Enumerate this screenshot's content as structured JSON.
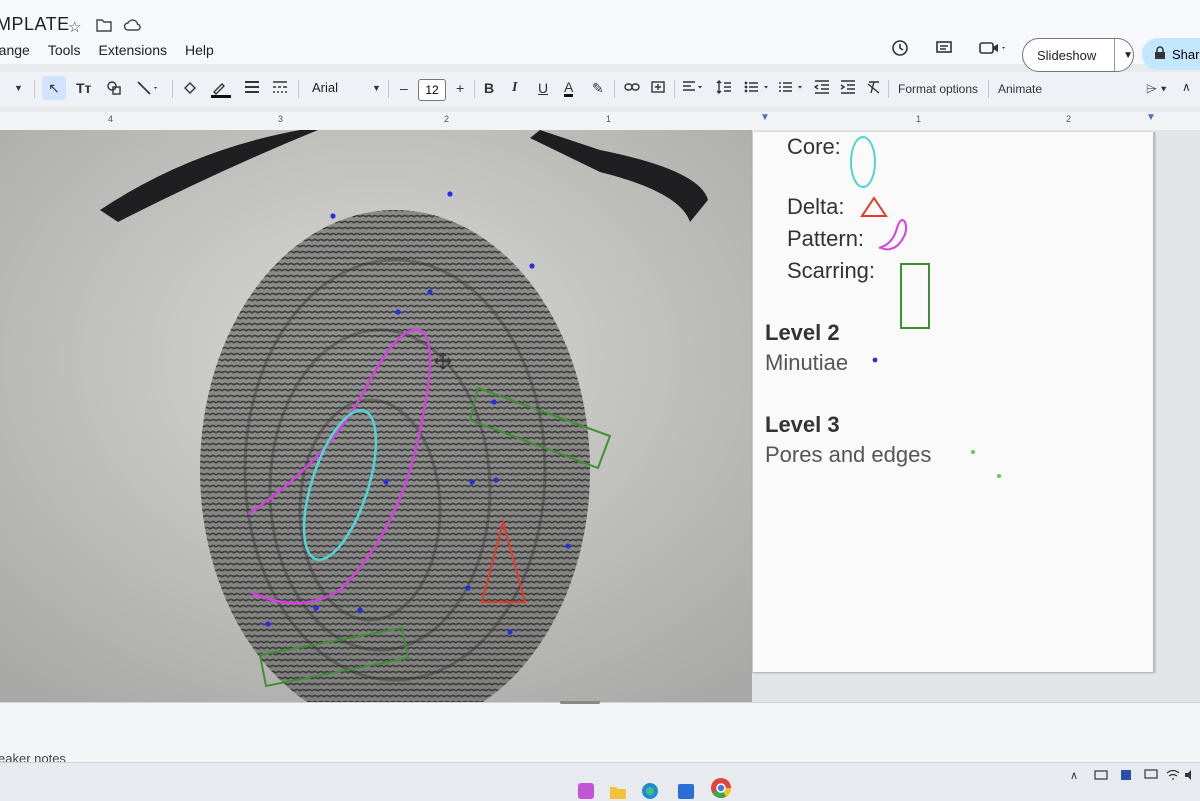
{
  "app": {
    "title_partial": "MPLATE",
    "menu": [
      "range",
      "Tools",
      "Extensions",
      "Help"
    ]
  },
  "header_actions": {
    "slideshow_label": "Slideshow",
    "share_label": "Share"
  },
  "toolbar": {
    "font_name": "Arial",
    "font_size": "12",
    "format_options": "Format options",
    "animate": "Animate",
    "bold": "B",
    "italic": "I",
    "underline": "U",
    "text_color": "A",
    "minus": "–",
    "plus": "+"
  },
  "ruler": {
    "ticks": [
      "4",
      "3",
      "2",
      "1",
      "1",
      "2"
    ]
  },
  "slide": {
    "core_label": "Core:",
    "delta_label": "Delta:",
    "pattern_label": "Pattern:",
    "scarring_label": "Scarring:",
    "level2_heading": "Level 2",
    "level2_text": "Minutiae",
    "level3_heading": "Level 3",
    "level3_text": "Pores and edges"
  },
  "notes": {
    "placeholder": "eaker notes"
  },
  "annotation_colors": {
    "core": "#4fd6d4",
    "delta": "#e23b2c",
    "pattern": "#d63fe0",
    "scarring": "#3f8f35",
    "minutiae": "#2a2ee0",
    "pores": "#5bd34a"
  },
  "icons": [
    "star-icon",
    "folder-move-icon",
    "cloud-icon",
    "history-icon",
    "comment-icon",
    "video-call-icon",
    "lock-icon",
    "select-arrow-icon",
    "text-box-icon",
    "shape-icon",
    "line-icon",
    "fill-color-icon",
    "border-color-icon",
    "border-weight-icon",
    "border-dash-icon",
    "highlight-icon",
    "link-icon",
    "insert-comment-icon",
    "align-icon",
    "line-spacing-icon",
    "bulleted-list-icon",
    "numbered-list-icon",
    "indent-decrease-icon",
    "indent-increase-icon",
    "clear-format-icon",
    "pointer-icon",
    "collapse-icon",
    "move-cursor-icon",
    "chrome-icon",
    "edge-icon"
  ]
}
